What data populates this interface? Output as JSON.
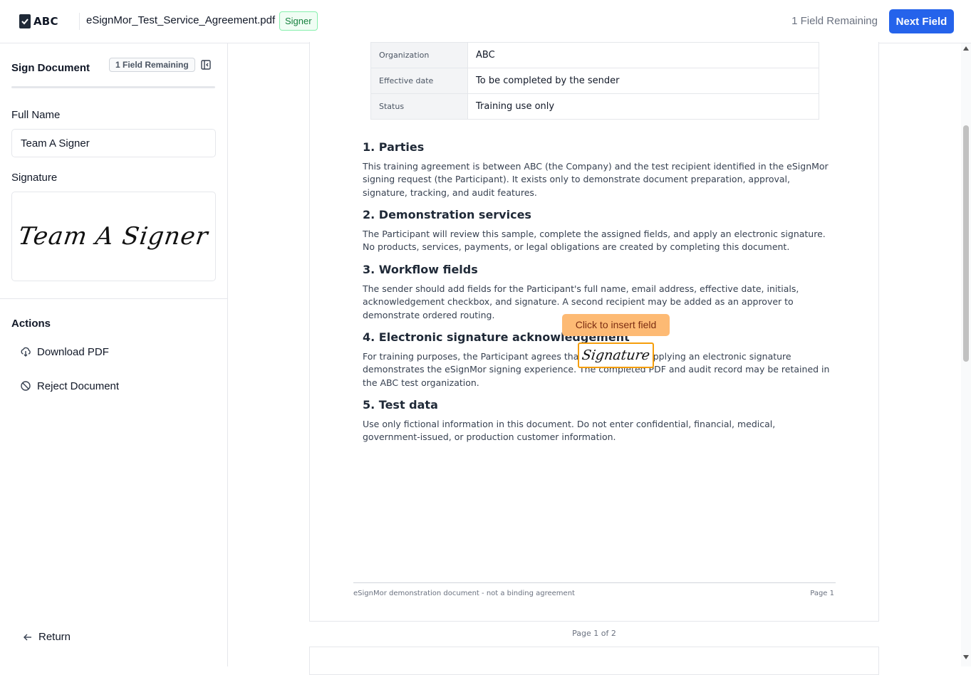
{
  "header": {
    "logo_text": "ABC",
    "document_title": "eSignMor_Test_Service_Agreement.pdf",
    "role_badge": "Signer",
    "fields_remaining": "1 Field Remaining",
    "next_field_label": "Next Field"
  },
  "sidebar": {
    "title": "Sign Document",
    "remaining_badge": "1 Field Remaining",
    "full_name_label": "Full Name",
    "full_name_value": "Team A Signer",
    "signature_label": "Signature",
    "signature_text": "Team A Signer",
    "actions_title": "Actions",
    "actions": [
      {
        "label": "Download PDF",
        "icon": "cloud-download-icon"
      },
      {
        "label": "Reject Document",
        "icon": "ban-icon"
      }
    ],
    "return_label": "Return"
  },
  "document": {
    "meta_rows": [
      {
        "key": "Organization",
        "value": "ABC"
      },
      {
        "key": "Effective date",
        "value": "To be completed by the sender"
      },
      {
        "key": "Status",
        "value": "Training use only"
      }
    ],
    "sections": [
      {
        "heading": "1. Parties",
        "body": "This training agreement is between ABC (the Company) and the test recipient identified in the eSignMor signing request (the Participant). It exists only to demonstrate document preparation, approval, signature, tracking, and audit features."
      },
      {
        "heading": "2. Demonstration services",
        "body": "The Participant will review this sample, complete the assigned fields, and apply an electronic signature. No products, services, payments, or legal obligations are created by completing this document."
      },
      {
        "heading": "3. Workflow fields",
        "body": "The sender should add fields for the Participant's full name, email address, effective date, initials, acknowledgement checkbox, and signature. A second recipient may be added as an approver to demonstrate ordered routing."
      },
      {
        "heading": "4. Electronic signature acknowledgement",
        "body": "For training purposes, the Participant agrees that submitting or applying an electronic signature demonstrates the eSignMor signing experience. The completed PDF and audit record may be retained in the ABC test organization."
      },
      {
        "heading": "5. Test data",
        "body": "Use only fictional information in this document. Do not enter confidential, financial, medical, government-issued, or production customer information."
      }
    ],
    "footer_left": "eSignMor demonstration document - not a binding agreement",
    "footer_right": "Page 1",
    "page_indicator": "Page 1 of 2"
  },
  "field": {
    "tooltip": "Click to insert field",
    "signature_placeholder": "Signature"
  },
  "colors": {
    "primary": "#2563eb",
    "signer_badge": "#15803d",
    "field_highlight": "#f59e0b",
    "tooltip_bg": "#fdba74"
  }
}
